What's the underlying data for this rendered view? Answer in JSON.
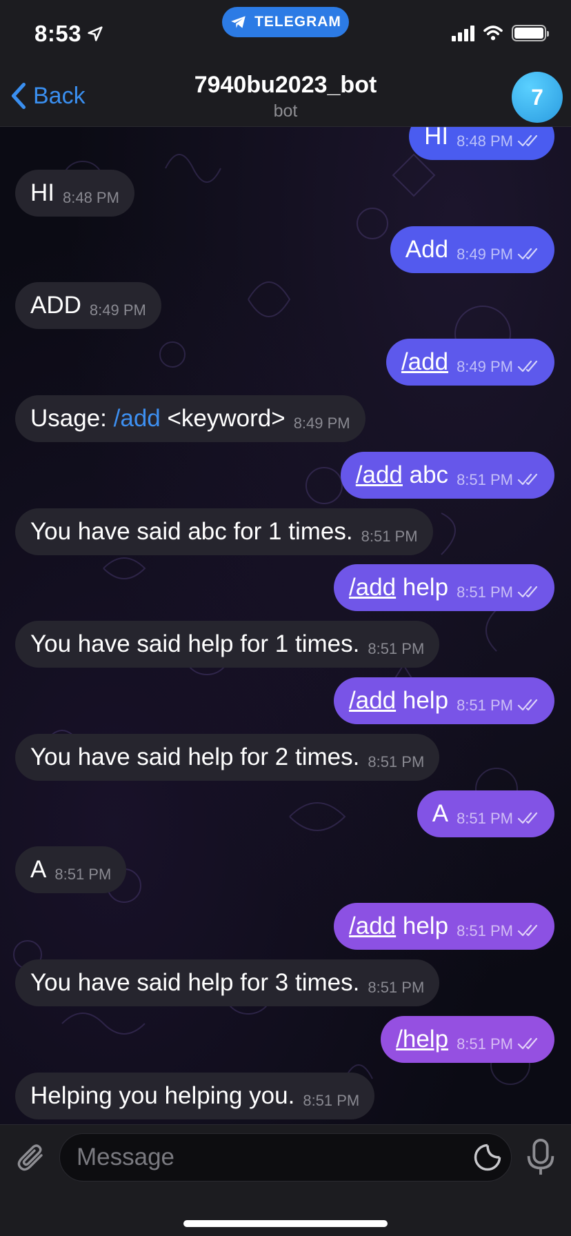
{
  "status": {
    "time": "8:53",
    "pill_label": "TELEGRAM"
  },
  "header": {
    "back_label": "Back",
    "title": "7940bu2023_bot",
    "subtitle": "bot",
    "avatar_badge": "7"
  },
  "colors": {
    "accent": "#3a8ff0",
    "incoming_bubble": "#26252e",
    "outgoing_top": "#4a5cf0",
    "outgoing_bottom": "#9a4fe0"
  },
  "messages": [
    {
      "dir": "out",
      "parts": [
        {
          "t": "HI"
        }
      ],
      "time": "8:48 PM"
    },
    {
      "dir": "in",
      "parts": [
        {
          "t": "HI"
        }
      ],
      "time": "8:48 PM"
    },
    {
      "dir": "out",
      "parts": [
        {
          "t": "Add"
        }
      ],
      "time": "8:49 PM"
    },
    {
      "dir": "in",
      "parts": [
        {
          "t": "ADD"
        }
      ],
      "time": "8:49 PM"
    },
    {
      "dir": "out",
      "parts": [
        {
          "t": "/add",
          "k": "cmd"
        }
      ],
      "time": "8:49 PM"
    },
    {
      "dir": "in",
      "parts": [
        {
          "t": "Usage: "
        },
        {
          "t": "/add",
          "k": "link"
        },
        {
          "t": " <keyword>"
        }
      ],
      "time": "8:49 PM"
    },
    {
      "dir": "out",
      "parts": [
        {
          "t": "/add",
          "k": "cmd"
        },
        {
          "t": " abc"
        }
      ],
      "time": "8:51 PM"
    },
    {
      "dir": "in",
      "parts": [
        {
          "t": "You have said abc for 1 times."
        }
      ],
      "time": "8:51 PM"
    },
    {
      "dir": "out",
      "parts": [
        {
          "t": "/add",
          "k": "cmd"
        },
        {
          "t": " help"
        }
      ],
      "time": "8:51 PM"
    },
    {
      "dir": "in",
      "parts": [
        {
          "t": "You have said help for 1 times."
        }
      ],
      "time": "8:51 PM"
    },
    {
      "dir": "out",
      "parts": [
        {
          "t": "/add",
          "k": "cmd"
        },
        {
          "t": " help"
        }
      ],
      "time": "8:51 PM"
    },
    {
      "dir": "in",
      "parts": [
        {
          "t": "You have said help for 2 times."
        }
      ],
      "time": "8:51 PM"
    },
    {
      "dir": "out",
      "parts": [
        {
          "t": "A"
        }
      ],
      "time": "8:51 PM"
    },
    {
      "dir": "in",
      "parts": [
        {
          "t": "A"
        }
      ],
      "time": "8:51 PM"
    },
    {
      "dir": "out",
      "parts": [
        {
          "t": "/add",
          "k": "cmd"
        },
        {
          "t": " help"
        }
      ],
      "time": "8:51 PM"
    },
    {
      "dir": "in",
      "parts": [
        {
          "t": "You have said help for 3 times."
        }
      ],
      "time": "8:51 PM"
    },
    {
      "dir": "out",
      "parts": [
        {
          "t": "/help",
          "k": "cmd"
        }
      ],
      "time": "8:51 PM"
    },
    {
      "dir": "in",
      "parts": [
        {
          "t": "Helping you helping you."
        }
      ],
      "time": "8:51 PM"
    }
  ],
  "composer": {
    "placeholder": "Message",
    "value": ""
  },
  "icons": {
    "attach": "paperclip-icon",
    "sticker": "sticker-icon",
    "mic": "microphone-icon",
    "ticks": "double-check-icon"
  }
}
